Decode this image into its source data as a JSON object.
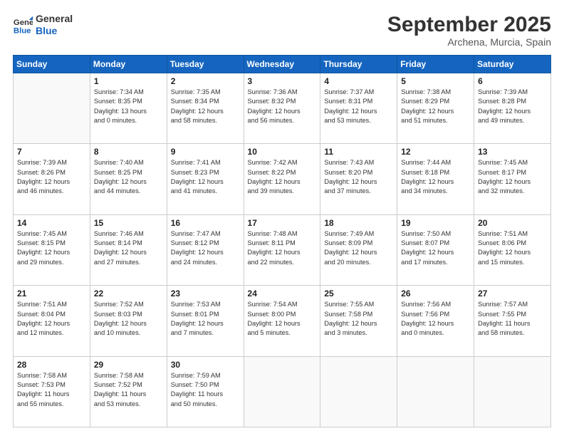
{
  "logo": {
    "line1": "General",
    "line2": "Blue"
  },
  "title": "September 2025",
  "subtitle": "Archena, Murcia, Spain",
  "weekdays": [
    "Sunday",
    "Monday",
    "Tuesday",
    "Wednesday",
    "Thursday",
    "Friday",
    "Saturday"
  ],
  "weeks": [
    [
      {
        "day": "",
        "info": ""
      },
      {
        "day": "1",
        "info": "Sunrise: 7:34 AM\nSunset: 8:35 PM\nDaylight: 13 hours\nand 0 minutes."
      },
      {
        "day": "2",
        "info": "Sunrise: 7:35 AM\nSunset: 8:34 PM\nDaylight: 12 hours\nand 58 minutes."
      },
      {
        "day": "3",
        "info": "Sunrise: 7:36 AM\nSunset: 8:32 PM\nDaylight: 12 hours\nand 56 minutes."
      },
      {
        "day": "4",
        "info": "Sunrise: 7:37 AM\nSunset: 8:31 PM\nDaylight: 12 hours\nand 53 minutes."
      },
      {
        "day": "5",
        "info": "Sunrise: 7:38 AM\nSunset: 8:29 PM\nDaylight: 12 hours\nand 51 minutes."
      },
      {
        "day": "6",
        "info": "Sunrise: 7:39 AM\nSunset: 8:28 PM\nDaylight: 12 hours\nand 49 minutes."
      }
    ],
    [
      {
        "day": "7",
        "info": "Sunrise: 7:39 AM\nSunset: 8:26 PM\nDaylight: 12 hours\nand 46 minutes."
      },
      {
        "day": "8",
        "info": "Sunrise: 7:40 AM\nSunset: 8:25 PM\nDaylight: 12 hours\nand 44 minutes."
      },
      {
        "day": "9",
        "info": "Sunrise: 7:41 AM\nSunset: 8:23 PM\nDaylight: 12 hours\nand 41 minutes."
      },
      {
        "day": "10",
        "info": "Sunrise: 7:42 AM\nSunset: 8:22 PM\nDaylight: 12 hours\nand 39 minutes."
      },
      {
        "day": "11",
        "info": "Sunrise: 7:43 AM\nSunset: 8:20 PM\nDaylight: 12 hours\nand 37 minutes."
      },
      {
        "day": "12",
        "info": "Sunrise: 7:44 AM\nSunset: 8:18 PM\nDaylight: 12 hours\nand 34 minutes."
      },
      {
        "day": "13",
        "info": "Sunrise: 7:45 AM\nSunset: 8:17 PM\nDaylight: 12 hours\nand 32 minutes."
      }
    ],
    [
      {
        "day": "14",
        "info": "Sunrise: 7:45 AM\nSunset: 8:15 PM\nDaylight: 12 hours\nand 29 minutes."
      },
      {
        "day": "15",
        "info": "Sunrise: 7:46 AM\nSunset: 8:14 PM\nDaylight: 12 hours\nand 27 minutes."
      },
      {
        "day": "16",
        "info": "Sunrise: 7:47 AM\nSunset: 8:12 PM\nDaylight: 12 hours\nand 24 minutes."
      },
      {
        "day": "17",
        "info": "Sunrise: 7:48 AM\nSunset: 8:11 PM\nDaylight: 12 hours\nand 22 minutes."
      },
      {
        "day": "18",
        "info": "Sunrise: 7:49 AM\nSunset: 8:09 PM\nDaylight: 12 hours\nand 20 minutes."
      },
      {
        "day": "19",
        "info": "Sunrise: 7:50 AM\nSunset: 8:07 PM\nDaylight: 12 hours\nand 17 minutes."
      },
      {
        "day": "20",
        "info": "Sunrise: 7:51 AM\nSunset: 8:06 PM\nDaylight: 12 hours\nand 15 minutes."
      }
    ],
    [
      {
        "day": "21",
        "info": "Sunrise: 7:51 AM\nSunset: 8:04 PM\nDaylight: 12 hours\nand 12 minutes."
      },
      {
        "day": "22",
        "info": "Sunrise: 7:52 AM\nSunset: 8:03 PM\nDaylight: 12 hours\nand 10 minutes."
      },
      {
        "day": "23",
        "info": "Sunrise: 7:53 AM\nSunset: 8:01 PM\nDaylight: 12 hours\nand 7 minutes."
      },
      {
        "day": "24",
        "info": "Sunrise: 7:54 AM\nSunset: 8:00 PM\nDaylight: 12 hours\nand 5 minutes."
      },
      {
        "day": "25",
        "info": "Sunrise: 7:55 AM\nSunset: 7:58 PM\nDaylight: 12 hours\nand 3 minutes."
      },
      {
        "day": "26",
        "info": "Sunrise: 7:56 AM\nSunset: 7:56 PM\nDaylight: 12 hours\nand 0 minutes."
      },
      {
        "day": "27",
        "info": "Sunrise: 7:57 AM\nSunset: 7:55 PM\nDaylight: 11 hours\nand 58 minutes."
      }
    ],
    [
      {
        "day": "28",
        "info": "Sunrise: 7:58 AM\nSunset: 7:53 PM\nDaylight: 11 hours\nand 55 minutes."
      },
      {
        "day": "29",
        "info": "Sunrise: 7:58 AM\nSunset: 7:52 PM\nDaylight: 11 hours\nand 53 minutes."
      },
      {
        "day": "30",
        "info": "Sunrise: 7:59 AM\nSunset: 7:50 PM\nDaylight: 11 hours\nand 50 minutes."
      },
      {
        "day": "",
        "info": ""
      },
      {
        "day": "",
        "info": ""
      },
      {
        "day": "",
        "info": ""
      },
      {
        "day": "",
        "info": ""
      }
    ]
  ]
}
